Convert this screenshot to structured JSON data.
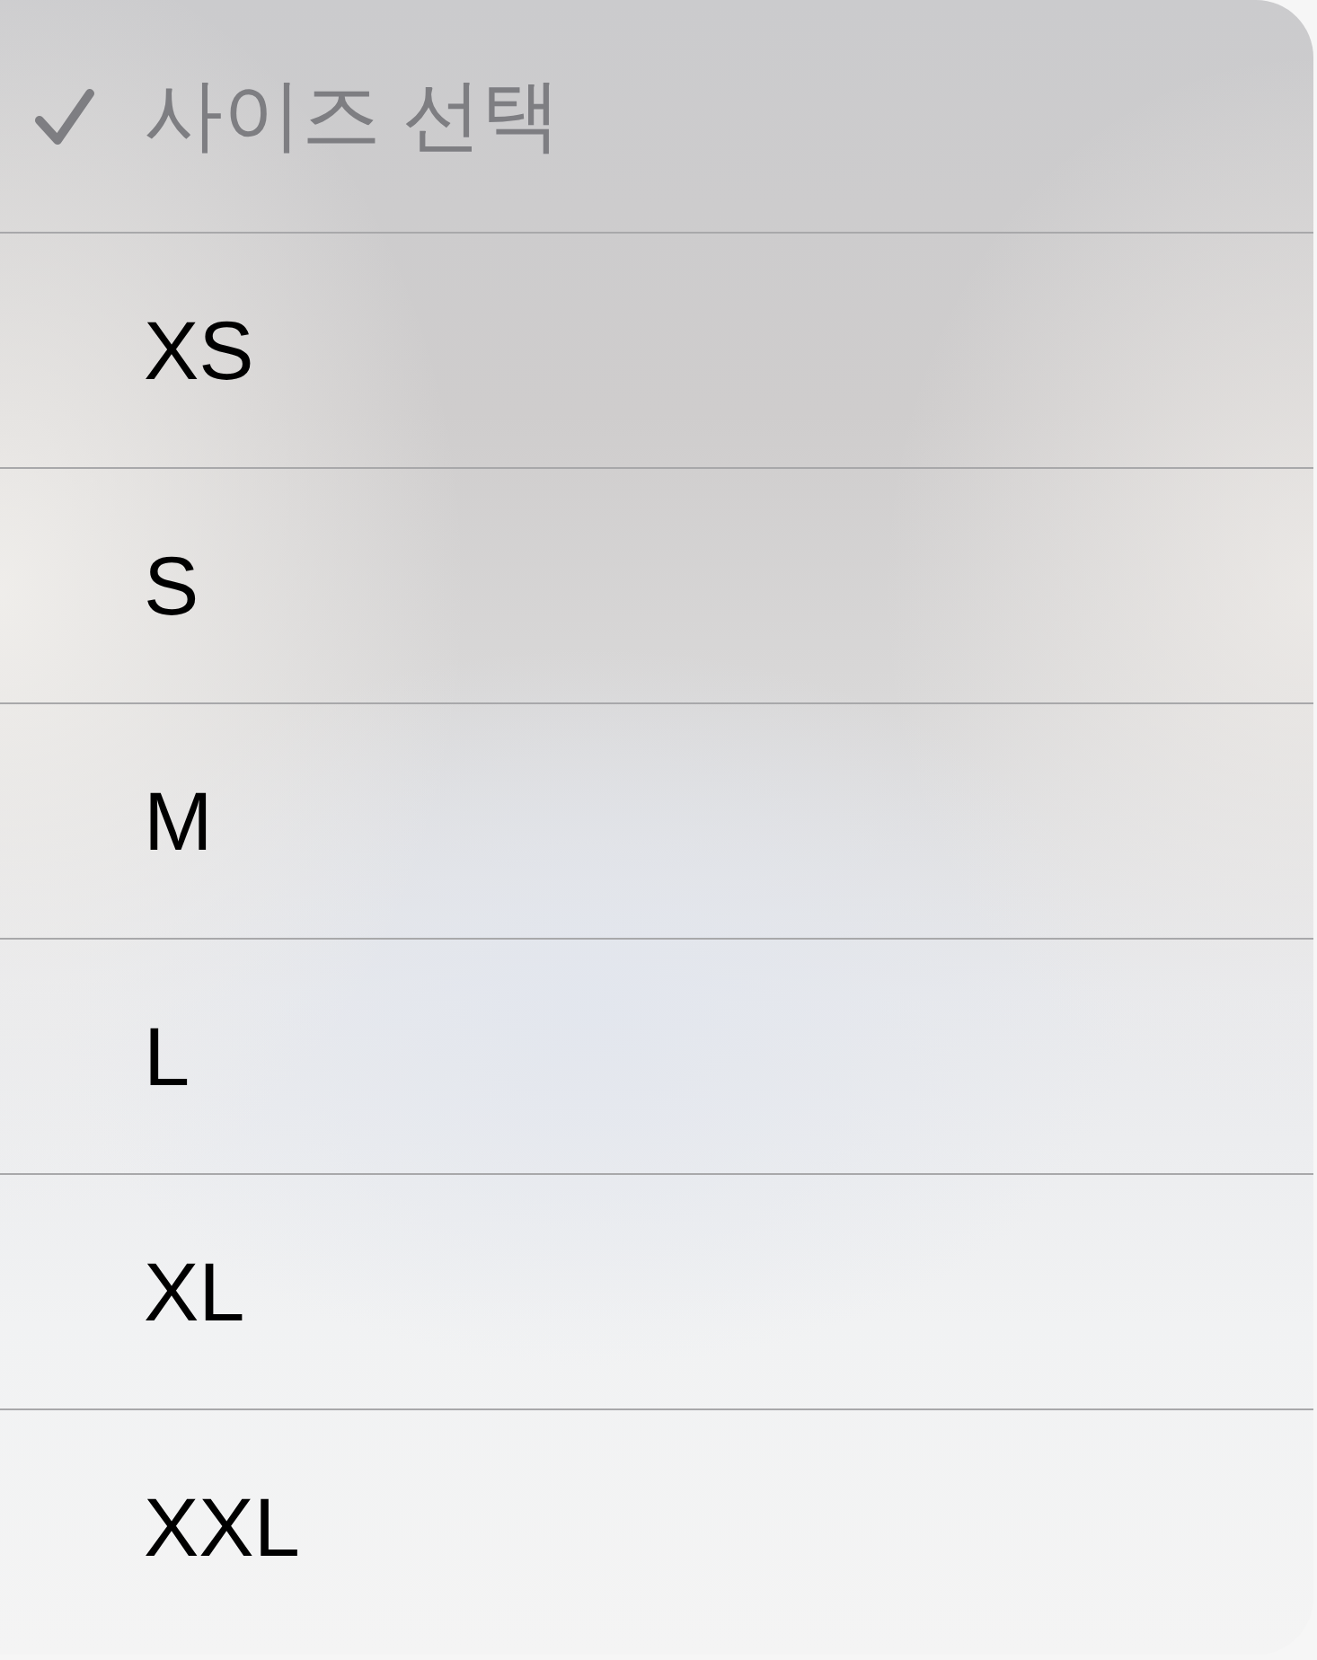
{
  "menu": {
    "options": [
      {
        "label": "사이즈 선택",
        "selected": true,
        "disabled": true
      },
      {
        "label": "XS",
        "selected": false,
        "disabled": false
      },
      {
        "label": "S",
        "selected": false,
        "disabled": false
      },
      {
        "label": "M",
        "selected": false,
        "disabled": false
      },
      {
        "label": "L",
        "selected": false,
        "disabled": false
      },
      {
        "label": "XL",
        "selected": false,
        "disabled": false
      },
      {
        "label": "XXL",
        "selected": false,
        "disabled": false
      }
    ]
  }
}
